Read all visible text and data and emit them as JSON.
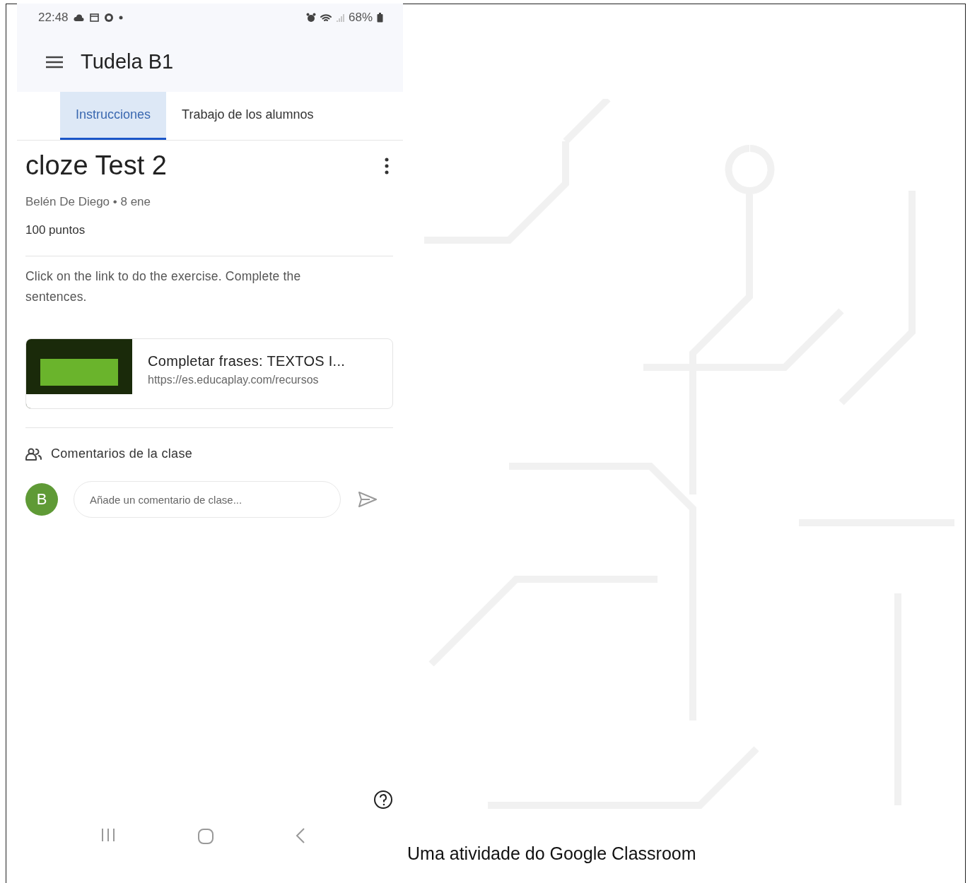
{
  "status_bar": {
    "time": "22:48",
    "battery": "68%"
  },
  "app_bar": {
    "title": "Tudela B1"
  },
  "tabs": [
    {
      "label": "Instrucciones",
      "selected": true
    },
    {
      "label": "Trabajo de los alumnos",
      "selected": false
    }
  ],
  "assignment": {
    "title": "cloze Test 2",
    "meta": "Belén De Diego • 8 ene",
    "points": "100 puntos",
    "description": "Click on the link to do the exercise. Complete the sentences."
  },
  "attachment": {
    "title": "Completar frases: TEXTOS I...",
    "url": "https://es.educaplay.com/recursos"
  },
  "comments": {
    "heading": "Comentarios de la clase",
    "avatar": "B",
    "placeholder": "Añade un comentario de clase..."
  },
  "caption": "Uma atividade do Google Classroom"
}
